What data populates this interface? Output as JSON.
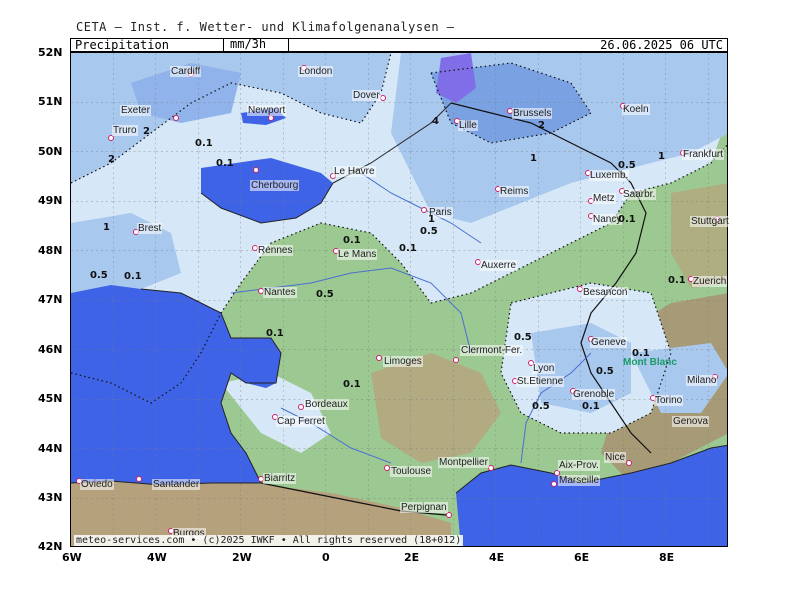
{
  "header": {
    "source": "CETA — Inst. f. Wetter- und Klimafolgenanalysen —"
  },
  "titlebar": {
    "variable": "Precipitation",
    "unit": "mm/3h",
    "datetime": "26.06.2025  06 UTC"
  },
  "footer": "meteo-services.com • (c)2025 IWKF • All rights reserved (18+012)",
  "axes": {
    "lat_labels": [
      "52N",
      "51N",
      "50N",
      "49N",
      "48N",
      "47N",
      "46N",
      "45N",
      "44N",
      "43N",
      "42N"
    ],
    "lon_labels": [
      "6W",
      "4W",
      "2W",
      "0",
      "2E",
      "4E",
      "6E",
      "8E"
    ]
  },
  "colors": {
    "sea": "#3f63e6",
    "land_dry": "#9cc892",
    "precip_light": "#d6e7f7",
    "precip_mid": "#a9c8ee",
    "precip_heavy": "#7aa2e2",
    "precip_max": "#7f6ee8",
    "terrain": "#b8a27a",
    "city_marker": "#d0206a"
  },
  "cities": [
    {
      "name": "London"
    },
    {
      "name": "Cardiff"
    },
    {
      "name": "Exeter"
    },
    {
      "name": "Truro"
    },
    {
      "name": "Newport"
    },
    {
      "name": "Dover"
    },
    {
      "name": "Lille"
    },
    {
      "name": "Brussels"
    },
    {
      "name": "Koeln"
    },
    {
      "name": "Frankfurt"
    },
    {
      "name": "Luxemb."
    },
    {
      "name": "Metz"
    },
    {
      "name": "Saarbr."
    },
    {
      "name": "Nancy"
    },
    {
      "name": "Stuttgart"
    },
    {
      "name": "Reims"
    },
    {
      "name": "Paris"
    },
    {
      "name": "Le Havre"
    },
    {
      "name": "Cherbourg"
    },
    {
      "name": "Brest"
    },
    {
      "name": "Rennes"
    },
    {
      "name": "Le Mans"
    },
    {
      "name": "Nantes"
    },
    {
      "name": "Auxerre"
    },
    {
      "name": "Besancon"
    },
    {
      "name": "Zuerich"
    },
    {
      "name": "Geneve"
    },
    {
      "name": "Mont Blanc"
    },
    {
      "name": "Limoges"
    },
    {
      "name": "Clermont-Fer."
    },
    {
      "name": "Lyon"
    },
    {
      "name": "St.Etienne"
    },
    {
      "name": "Grenoble"
    },
    {
      "name": "Milano"
    },
    {
      "name": "Torino"
    },
    {
      "name": "Genova"
    },
    {
      "name": "Bordeaux"
    },
    {
      "name": "Cap Ferret"
    },
    {
      "name": "Toulouse"
    },
    {
      "name": "Montpellier"
    },
    {
      "name": "Aix-Prov."
    },
    {
      "name": "Marseille"
    },
    {
      "name": "Nice"
    },
    {
      "name": "Biarritz"
    },
    {
      "name": "Perpignan"
    },
    {
      "name": "Santander"
    },
    {
      "name": "Oviedo"
    },
    {
      "name": "Burgos"
    }
  ],
  "contour_labels": [
    "4",
    "2",
    "2",
    "2",
    "1",
    "1",
    "1",
    "1",
    "0.5",
    "0.5",
    "0.5",
    "0.5",
    "0.5",
    "0.5",
    "0.5",
    "0.1",
    "0.1",
    "0.1",
    "0.1",
    "0.1",
    "0.1",
    "0.1",
    "0.1",
    "0.1",
    "0.1",
    "0.1"
  ]
}
